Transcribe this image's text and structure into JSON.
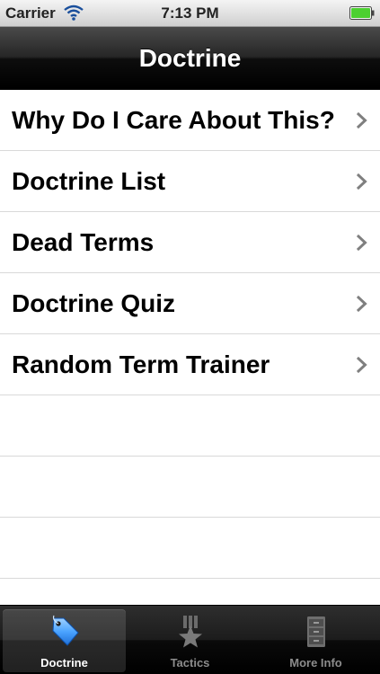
{
  "status_bar": {
    "carrier": "Carrier",
    "time": "7:13 PM",
    "signal_icon": "wifi-icon",
    "battery_icon": "battery-icon",
    "battery_color": "#4cd030"
  },
  "nav_bar": {
    "title": "Doctrine"
  },
  "table": {
    "rows": [
      {
        "label": "Why Do I Care About This?",
        "icon": "chevron-right-icon"
      },
      {
        "label": "Doctrine List",
        "icon": "chevron-right-icon"
      },
      {
        "label": "Dead Terms",
        "icon": "chevron-right-icon"
      },
      {
        "label": "Doctrine Quiz",
        "icon": "chevron-right-icon"
      },
      {
        "label": "Random Term Trainer",
        "icon": "chevron-right-icon"
      }
    ]
  },
  "tab_bar": {
    "tabs": [
      {
        "label": "Doctrine",
        "icon": "tag-icon",
        "selected": true
      },
      {
        "label": "Tactics",
        "icon": "star-icon",
        "selected": false
      },
      {
        "label": "More Info",
        "icon": "file-cabinet-icon",
        "selected": false
      }
    ],
    "accent_color": "#4aa3ff"
  }
}
